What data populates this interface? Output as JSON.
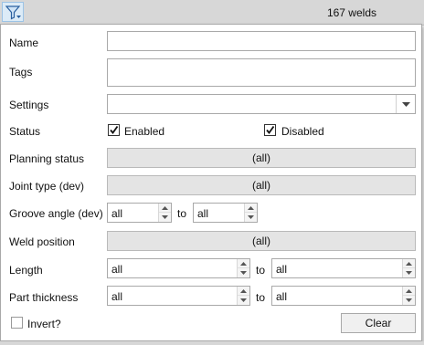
{
  "toolbar": {
    "count_text": "167 welds",
    "filter_icon": "filter-dropdown-icon"
  },
  "form": {
    "name": {
      "label": "Name",
      "value": ""
    },
    "tags": {
      "label": "Tags",
      "value": ""
    },
    "settings": {
      "label": "Settings",
      "selected": ""
    },
    "status": {
      "label": "Status",
      "enabled": {
        "label": "Enabled",
        "checked": true
      },
      "disabled": {
        "label": "Disabled",
        "checked": true
      }
    },
    "planning_status": {
      "label": "Planning status",
      "value": "(all)"
    },
    "joint_type": {
      "label": "Joint type (dev)",
      "value": "(all)"
    },
    "groove_angle": {
      "label": "Groove angle (dev)",
      "from": "all",
      "to_label": "to",
      "to": "all"
    },
    "weld_position": {
      "label": "Weld position",
      "value": "(all)"
    },
    "length": {
      "label": "Length",
      "from": "all",
      "to_label": "to",
      "to": "all"
    },
    "part_thickness": {
      "label": "Part thickness",
      "from": "all",
      "to_label": "to",
      "to": "all"
    },
    "invert": {
      "label": "Invert?",
      "checked": false
    },
    "clear_label": "Clear"
  }
}
